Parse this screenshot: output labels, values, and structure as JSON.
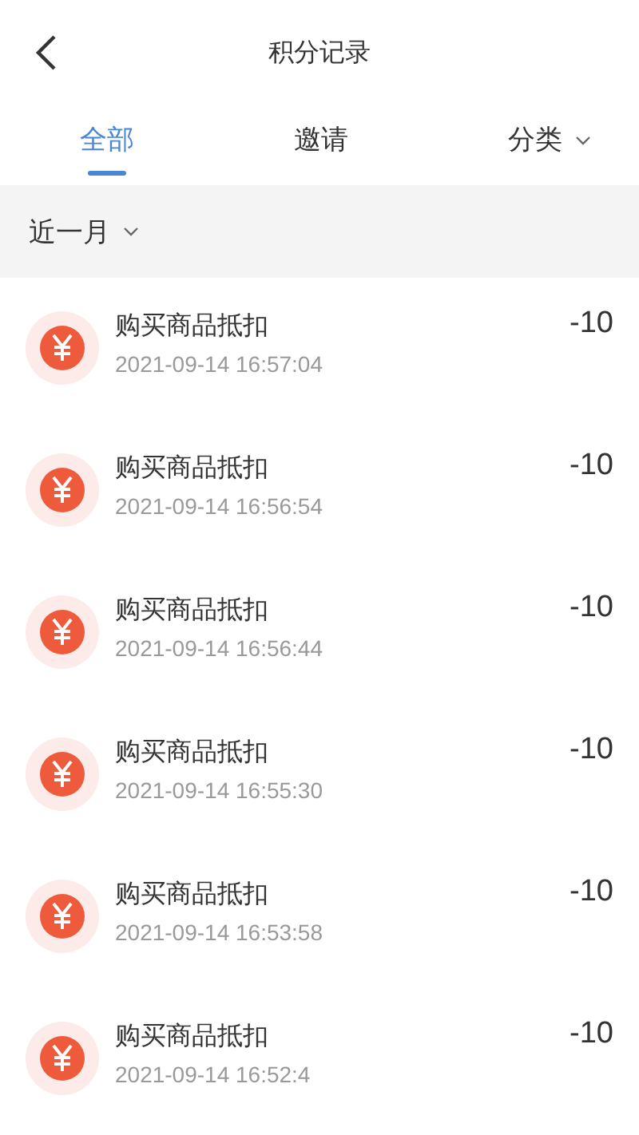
{
  "header": {
    "title": "积分记录"
  },
  "tabs": [
    {
      "label": "全部",
      "selected": true,
      "dropdown": false
    },
    {
      "label": "邀请",
      "selected": false,
      "dropdown": false
    },
    {
      "label": "分类",
      "selected": false,
      "dropdown": true
    }
  ],
  "filter": {
    "label": "近一月"
  },
  "records": [
    {
      "title": "购买商品抵扣",
      "time": "2021-09-14 16:57:04",
      "amount": "-10"
    },
    {
      "title": "购买商品抵扣",
      "time": "2021-09-14 16:56:54",
      "amount": "-10"
    },
    {
      "title": "购买商品抵扣",
      "time": "2021-09-14 16:56:44",
      "amount": "-10"
    },
    {
      "title": "购买商品抵扣",
      "time": "2021-09-14 16:55:30",
      "amount": "-10"
    },
    {
      "title": "购买商品抵扣",
      "time": "2021-09-14 16:53:58",
      "amount": "-10"
    },
    {
      "title": "购买商品抵扣",
      "time": "2021-09-14 16:52:4",
      "amount": "-10"
    }
  ]
}
